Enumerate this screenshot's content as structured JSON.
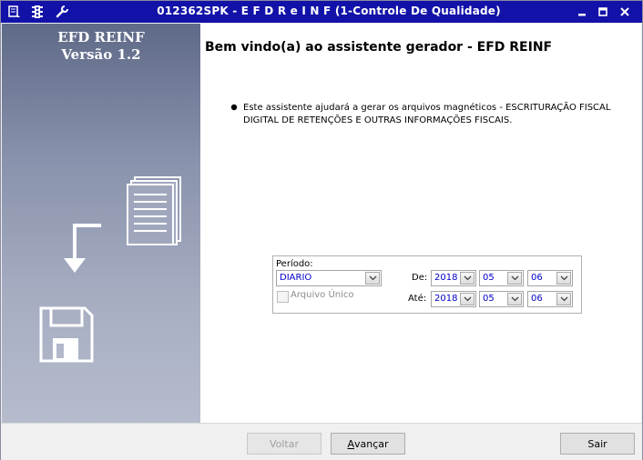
{
  "window": {
    "title": "012362SPK - E F D   R e I N F (1-Controle De Qualidade)",
    "titlebar_color": "#1212a8",
    "left_icons": [
      "notes-icon",
      "traffic-light-icon",
      "wrench-icon"
    ],
    "controls": [
      "minimize-icon",
      "maximize-icon",
      "close-icon"
    ]
  },
  "sidebar": {
    "title_line1": "EFD REINF",
    "title_line2": "Versão 1.2",
    "illustrations": [
      "documents-icon",
      "arrow-down-left-icon",
      "floppy-disk-icon"
    ]
  },
  "main": {
    "heading": "Bem vindo(a) ao assistente gerador - EFD REINF",
    "intro": "Este assistente ajudará a gerar os arquivos magnéticos - ESCRITURAÇÃO FISCAL DIGITAL DE RETENÇÕES E OUTRAS INFORMAÇÕES FISCAIS."
  },
  "period": {
    "label": "Período:",
    "frequency": "DIARIO",
    "single_file_label": "Arquivo Único",
    "single_file_checked": false,
    "from_label": "De:",
    "to_label": "Até:",
    "from": {
      "year": "2018",
      "month": "05",
      "day": "06"
    },
    "to": {
      "year": "2018",
      "month": "05",
      "day": "06"
    }
  },
  "buttons": {
    "back": "Voltar",
    "back_enabled": false,
    "next_mnemonic": "A",
    "next_rest": "vançar",
    "exit": "Sair"
  }
}
